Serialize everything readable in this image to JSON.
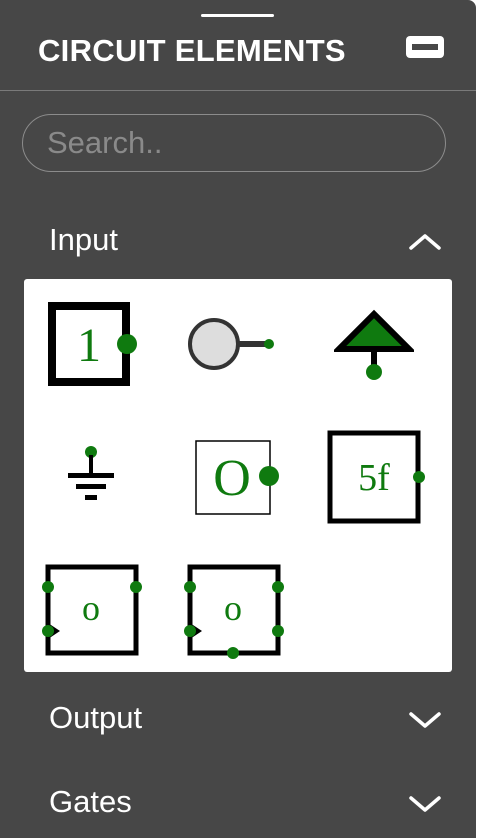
{
  "panel": {
    "title": "CIRCUIT ELEMENTS"
  },
  "search": {
    "placeholder": "Search.."
  },
  "sections": [
    {
      "label": "Input",
      "state": "expanded",
      "chevron": "chevron-up-icon"
    },
    {
      "label": "Output",
      "state": "collapsed",
      "chevron": "chevron-down-icon"
    },
    {
      "label": "Gates",
      "state": "collapsed",
      "chevron": "chevron-down-icon"
    }
  ],
  "input_elements": [
    {
      "name": "input-element",
      "glyph": "1"
    },
    {
      "name": "button-element",
      "glyph": ""
    },
    {
      "name": "power-element",
      "glyph": ""
    },
    {
      "name": "ground-element",
      "glyph": ""
    },
    {
      "name": "constant-value-element",
      "glyph": "O"
    },
    {
      "name": "stepper-element",
      "glyph": "5f"
    },
    {
      "name": "random-element",
      "glyph": "o"
    },
    {
      "name": "counter-element",
      "glyph": "o"
    }
  ],
  "colors": {
    "panel_bg": "#474747",
    "pin_green": "#0f7a0f",
    "text_white": "#ffffff",
    "placeholder": "#8a8a8a"
  }
}
